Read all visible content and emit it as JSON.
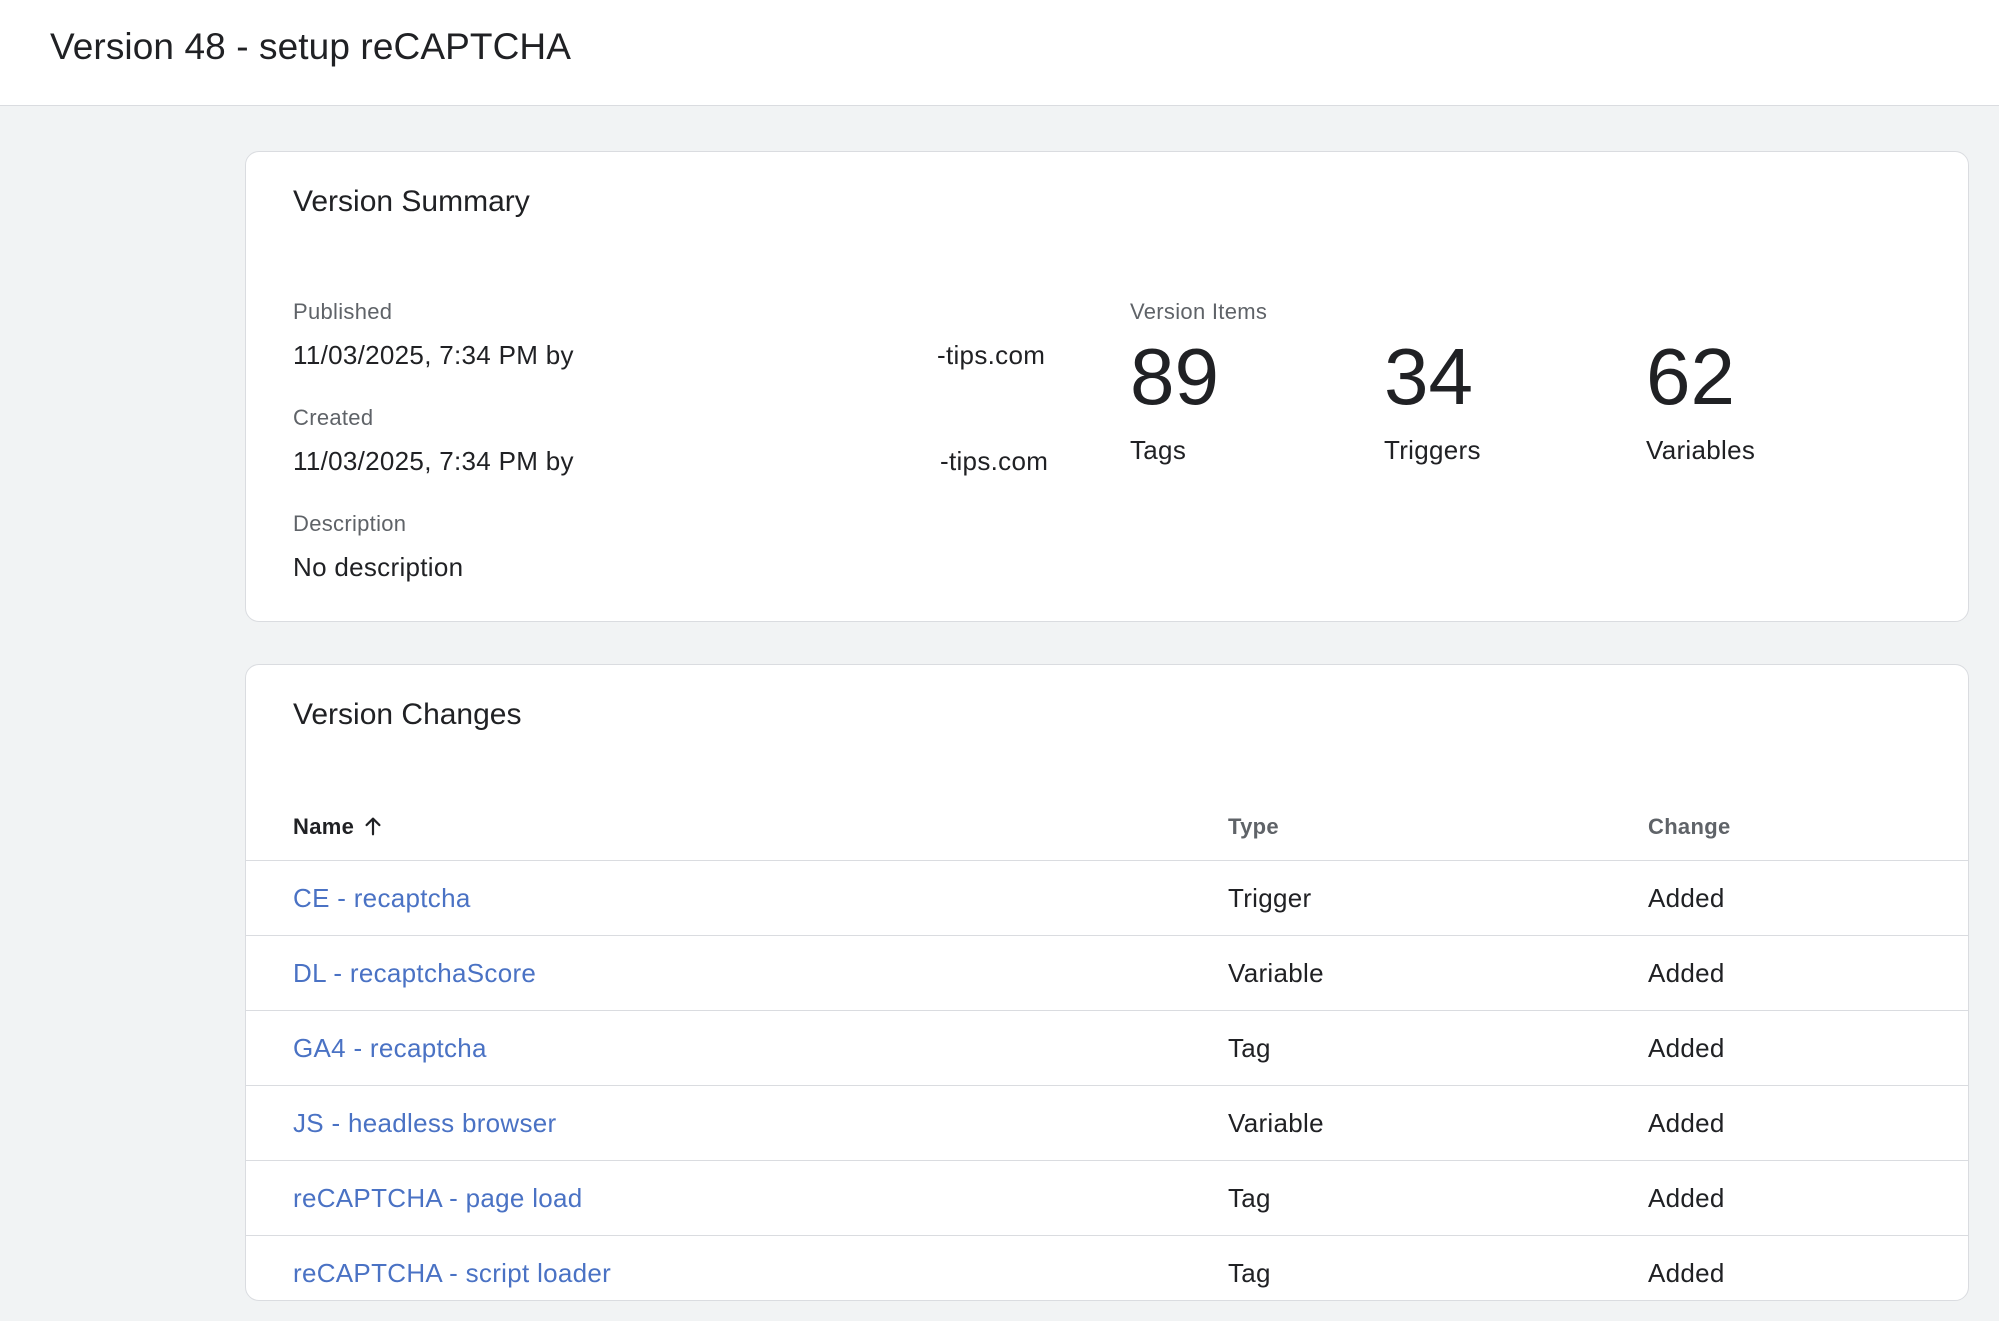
{
  "header": {
    "title": "Version 48 - setup reCAPTCHA"
  },
  "summary": {
    "title": "Version Summary",
    "published_label": "Published",
    "published_value": "11/03/2025, 7:34 PM by",
    "published_email_tail": "-tips.com",
    "created_label": "Created",
    "created_value": "11/03/2025, 7:34 PM by",
    "created_email_tail": "-tips.com",
    "description_label": "Description",
    "description_value": "No description",
    "items_label": "Version Items",
    "stats": [
      {
        "value": "89",
        "label": "Tags"
      },
      {
        "value": "34",
        "label": "Triggers"
      },
      {
        "value": "62",
        "label": "Variables"
      }
    ]
  },
  "changes": {
    "title": "Version Changes",
    "columns": {
      "name": "Name",
      "type": "Type",
      "change": "Change"
    },
    "sort_icon": "arrow-up-icon",
    "rows": [
      {
        "name": "CE - recaptcha",
        "type": "Trigger",
        "change": "Added"
      },
      {
        "name": "DL - recaptchaScore",
        "type": "Variable",
        "change": "Added"
      },
      {
        "name": "GA4 - recaptcha",
        "type": "Tag",
        "change": "Added"
      },
      {
        "name": "JS - headless browser",
        "type": "Variable",
        "change": "Added"
      },
      {
        "name": "reCAPTCHA - page load",
        "type": "Tag",
        "change": "Added"
      },
      {
        "name": "reCAPTCHA - script loader",
        "type": "Tag",
        "change": "Added"
      }
    ]
  },
  "colors": {
    "link": "#4a72c4",
    "background": "#f1f3f4",
    "card": "#ffffff",
    "divider": "#dadce0"
  }
}
